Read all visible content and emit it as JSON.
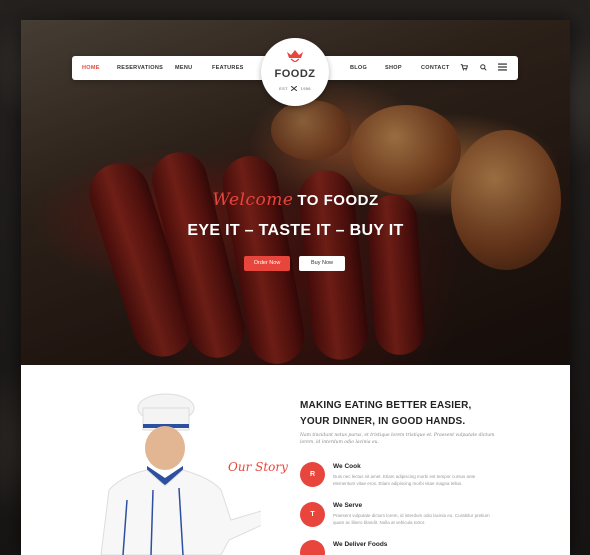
{
  "nav": {
    "items": [
      "HOME",
      "RESERVATIONS",
      "MENU",
      "FEATURES",
      "BLOG",
      "SHOP",
      "CONTACT"
    ],
    "active": "HOME",
    "icons": [
      "cart-icon",
      "search-icon",
      "menu-icon"
    ]
  },
  "logo": {
    "name": "FOODZ",
    "est_left": "EST",
    "est_right": "1956"
  },
  "hero": {
    "welcome_script": "Welcome",
    "welcome_rest": "TO FOODZ",
    "tagline": "EYE IT – TASTE IT – BUY IT",
    "order_button": "Order Now",
    "buy_button": "Buy Now"
  },
  "about": {
    "title_line1": "MAKING EATING BETTER EASIER,",
    "title_line2": "YOUR DINNER, IN GOOD HANDS.",
    "intro": "Nam tincidunt netus purus, et tristique lorem tristique et. Praesent vulputate dictum lorem, id interdum odio lacinia eu.",
    "our_story": "Our Story",
    "features": [
      {
        "badge": "R",
        "title": "We Cook",
        "desc": "Duis nec lectus sit amet. Etiam adipiscing morbi est tempor cursus ante elementum vitae eros. Etiam adipiscing morbi vitae magna tellus."
      },
      {
        "badge": "T",
        "title": "We Serve",
        "desc": "Praesent vulputate dictum lorem, id interdum odio lacinia eu. Curabitur pretium quam ac libero blandit. Nulla at vehicula tortor."
      },
      {
        "badge": "",
        "title": "We Deliver Foods",
        "desc": ""
      }
    ]
  },
  "colors": {
    "accent": "#e8453c",
    "dark": "#222222"
  }
}
